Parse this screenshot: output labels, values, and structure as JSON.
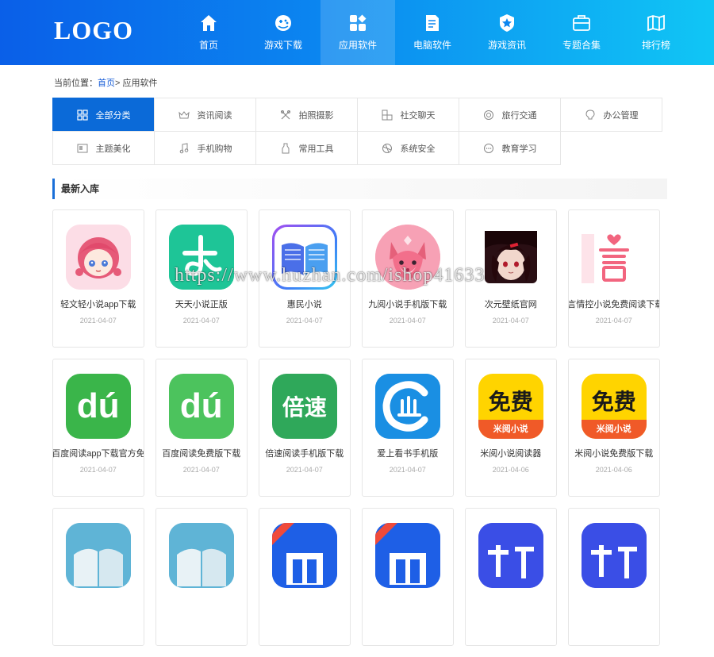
{
  "header": {
    "logo": "LOGO",
    "nav": [
      {
        "label": "首页",
        "icon": "home-icon"
      },
      {
        "label": "游戏下载",
        "icon": "gamepad-icon"
      },
      {
        "label": "应用软件",
        "icon": "apps-grid-icon",
        "active": true
      },
      {
        "label": "电脑软件",
        "icon": "document-icon"
      },
      {
        "label": "游戏资讯",
        "icon": "star-badge-icon"
      },
      {
        "label": "专题合集",
        "icon": "briefcase-icon"
      },
      {
        "label": "排行榜",
        "icon": "map-book-icon"
      }
    ]
  },
  "breadcrumb": {
    "prefix": "当前位置：",
    "home": "首页",
    "separator": "> ",
    "current": "应用软件"
  },
  "categories": [
    [
      {
        "label": "全部分类",
        "icon": "grid-icon",
        "active": true
      },
      {
        "label": "资讯阅读",
        "icon": "crown-icon"
      },
      {
        "label": "拍照摄影",
        "icon": "tools-cross-icon"
      },
      {
        "label": "社交聊天",
        "icon": "blocks-icon"
      },
      {
        "label": "旅行交通",
        "icon": "target-icon"
      },
      {
        "label": "办公管理",
        "icon": "bulb-icon"
      }
    ],
    [
      {
        "label": "主题美化",
        "icon": "id-card-icon"
      },
      {
        "label": "手机购物",
        "icon": "music-note-icon"
      },
      {
        "label": "常用工具",
        "icon": "bottle-icon"
      },
      {
        "label": "系统安全",
        "icon": "ball-icon"
      },
      {
        "label": "教育学习",
        "icon": "dots-circle-icon"
      }
    ]
  ],
  "section": {
    "title": "最新入库"
  },
  "apps": [
    [
      {
        "name": "轻文轻小说app下载",
        "date": "2021-04-07",
        "icon": "anime-girl-icon"
      },
      {
        "name": "天天小说正版",
        "date": "2021-04-07",
        "icon": "green-book-logo-icon"
      },
      {
        "name": "惠民小说",
        "date": "2021-04-07",
        "icon": "open-book-icon"
      },
      {
        "name": "九阅小说手机版下载",
        "date": "2021-04-07",
        "icon": "pink-fox-icon"
      },
      {
        "name": "次元壁纸官网",
        "date": "2021-04-07",
        "icon": "dark-anime-icon"
      },
      {
        "name": "言情控小说免费阅读下载",
        "date": "2021-04-07",
        "icon": "yan-heart-icon"
      }
    ],
    [
      {
        "name": "百度阅读app下载官方免费",
        "date": "2021-04-07",
        "icon": "du-logo-icon",
        "glyph": "dú",
        "bg": "#3ab54a"
      },
      {
        "name": "百度阅读免费版下载",
        "date": "2021-04-07",
        "icon": "du-logo-icon",
        "glyph": "dú",
        "bg": "#4cc35d"
      },
      {
        "name": "倍速阅读手机版下载",
        "date": "2021-04-07",
        "icon": "beisu-logo-icon",
        "glyph": "倍速",
        "bg": "#2fa85a"
      },
      {
        "name": "爱上看书手机版",
        "date": "2021-04-07",
        "icon": "c-book-logo-icon",
        "glyph": "",
        "bg": "#1a8fe3"
      },
      {
        "name": "米阅小说阅读器",
        "date": "2021-04-06",
        "icon": "free-read-icon",
        "glyph": "免费",
        "sub": "米阅小说",
        "bg": "#ffd400"
      },
      {
        "name": "米阅小说免费版下载",
        "date": "2021-04-06",
        "icon": "free-read-icon",
        "glyph": "免费",
        "sub": "米阅小说",
        "bg": "#ffd400"
      }
    ],
    [
      {
        "icon": "book-cyan-icon",
        "bg": "#5fb4d6"
      },
      {
        "icon": "book-cyan-icon",
        "bg": "#5fb4d6"
      },
      {
        "icon": "blue-official-icon",
        "bg": "#1e5fe6"
      },
      {
        "icon": "blue-official-icon",
        "bg": "#1e5fe6"
      },
      {
        "icon": "indigo-read-icon",
        "bg": "#3a4ee6"
      },
      {
        "icon": "indigo-read-icon",
        "bg": "#3a4ee6"
      }
    ]
  ],
  "watermark": "https://www.huzhan.com/ishop41633"
}
